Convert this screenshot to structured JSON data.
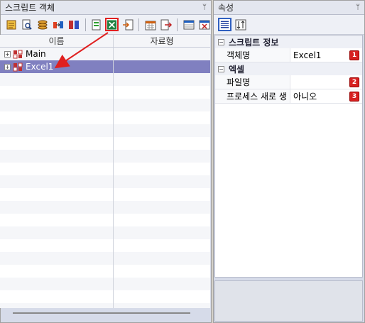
{
  "left_pane": {
    "title": "스크립트 객체",
    "pin": "ᛘ",
    "columns": [
      "이름",
      "자료형"
    ],
    "nodes": [
      {
        "name": "Main",
        "type": "",
        "expander": "+"
      },
      {
        "name": "Excel1",
        "type": "",
        "expander": "+"
      }
    ],
    "toolbar_icons": [
      "list-icon",
      "search-doc-icon",
      "stack-icon",
      "arrow-right-icon",
      "grid-icon",
      "new-object-icon",
      "excel-object-icon",
      "import-icon",
      "calendar-icon",
      "export-icon",
      "table-icon",
      "delete-icon"
    ]
  },
  "right_pane": {
    "title": "속성",
    "pin": "ᛘ",
    "categories": [
      {
        "name": "스크립트 정보",
        "rows": [
          {
            "name": "객체명",
            "value": "Excel1",
            "badge": "1"
          }
        ]
      },
      {
        "name": "엑셀",
        "rows": [
          {
            "name": "파일명",
            "value": "",
            "badge": "2"
          },
          {
            "name": "프로세스 새로 생",
            "value": "아니오",
            "badge": "3"
          }
        ]
      }
    ]
  },
  "colors": {
    "selection": "#8080c0",
    "annotation": "#e02020"
  }
}
